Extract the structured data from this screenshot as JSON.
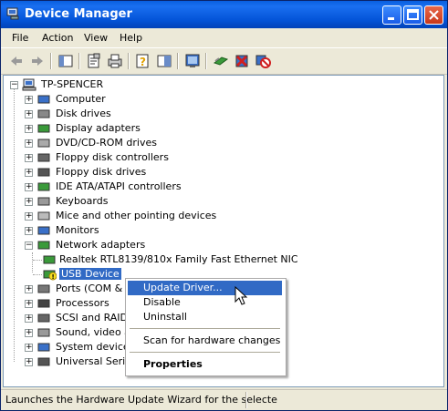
{
  "window": {
    "title": "Device Manager"
  },
  "menu": [
    "File",
    "Action",
    "View",
    "Help"
  ],
  "toolbar": [
    "back-icon",
    "forward-icon",
    "show-hide-tree-icon",
    "properties-icon",
    "print-icon",
    "help-icon",
    "view-icon",
    "scan-hardware-icon",
    "update-driver-icon",
    "uninstall-icon",
    "disable-icon"
  ],
  "tree": {
    "root": "TP-SPENCER",
    "items": [
      {
        "label": "Computer",
        "icon": "computer-icon",
        "expanded": false
      },
      {
        "label": "Disk drives",
        "icon": "disk-drive-icon",
        "expanded": false
      },
      {
        "label": "Display adapters",
        "icon": "display-adapter-icon",
        "expanded": false
      },
      {
        "label": "DVD/CD-ROM drives",
        "icon": "cdrom-icon",
        "expanded": false
      },
      {
        "label": "Floppy disk controllers",
        "icon": "floppy-controller-icon",
        "expanded": false
      },
      {
        "label": "Floppy disk drives",
        "icon": "floppy-drive-icon",
        "expanded": false
      },
      {
        "label": "IDE ATA/ATAPI controllers",
        "icon": "ide-controller-icon",
        "expanded": false
      },
      {
        "label": "Keyboards",
        "icon": "keyboard-icon",
        "expanded": false
      },
      {
        "label": "Mice and other pointing devices",
        "icon": "mouse-icon",
        "expanded": false
      },
      {
        "label": "Monitors",
        "icon": "monitor-icon",
        "expanded": false
      },
      {
        "label": "Network adapters",
        "icon": "network-adapter-icon",
        "expanded": true
      },
      {
        "label": "Realtek RTL8139/810x Family Fast Ethernet NIC",
        "icon": "nic-icon",
        "child": true
      },
      {
        "label": "USB Device",
        "icon": "warning-nic-icon",
        "child": true,
        "selected": true
      },
      {
        "label": "Ports (COM & LPT)",
        "icon": "port-icon",
        "expanded": false
      },
      {
        "label": "Processors",
        "icon": "processor-icon",
        "expanded": false
      },
      {
        "label": "SCSI and RAID controllers",
        "icon": "scsi-icon",
        "expanded": false
      },
      {
        "label": "Sound, video and game controllers",
        "icon": "sound-icon",
        "expanded": false
      },
      {
        "label": "System devices",
        "icon": "system-device-icon",
        "expanded": false
      },
      {
        "label": "Universal Serial Bus controllers",
        "icon": "usb-icon",
        "expanded": false
      }
    ]
  },
  "context_menu": {
    "items": [
      "Update Driver...",
      "Disable",
      "Uninstall",
      "Scan for hardware changes",
      "Properties"
    ],
    "highlighted": "Update Driver..."
  },
  "status": {
    "text": "Launches the Hardware Update Wizard for the selecte"
  },
  "colors": {
    "title_blue": "#0454d8",
    "selection": "#316ac5",
    "chrome": "#ece9d8"
  }
}
